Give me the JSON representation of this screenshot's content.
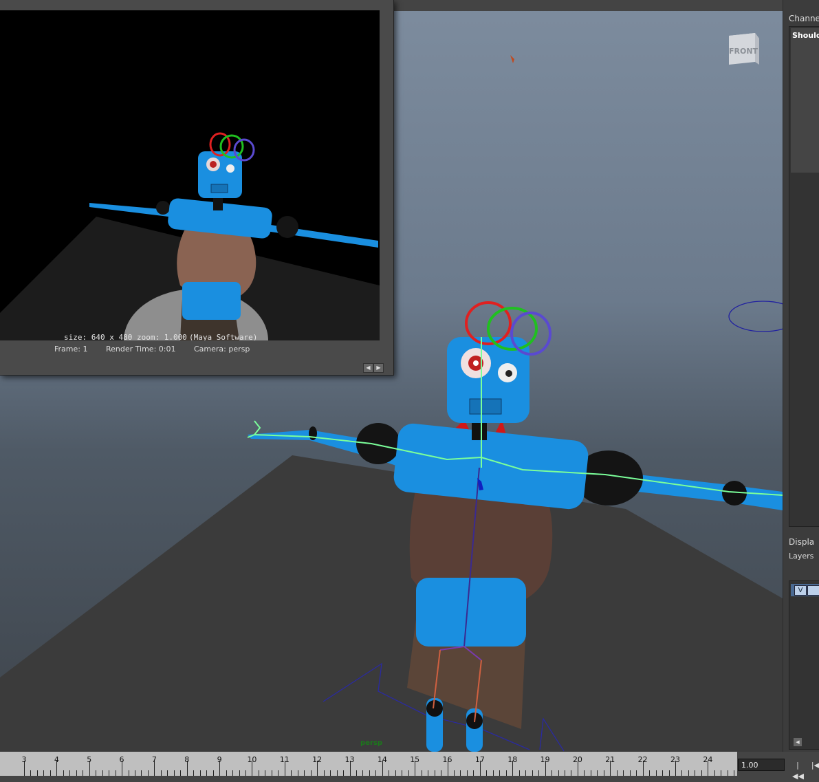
{
  "render_view": {
    "size_label": "size: 640 x 480 zoom: 1.000",
    "renderer_label": "(Maya Software)",
    "frame_label": "Frame: 1",
    "render_time_label": "Render Time: 0:01",
    "camera_label": "Camera: persp"
  },
  "viewport": {
    "camera_name": "persp",
    "viewcube_face": "FRONT"
  },
  "channel_box": {
    "tab_label": "Channe",
    "selected_object": "Shoulde"
  },
  "layer_editor": {
    "tab_label": "Displa",
    "menu_label": "Layers",
    "layer_visibility_label": "V"
  },
  "timeline": {
    "ticks": [
      "3",
      "4",
      "5",
      "6",
      "7",
      "8",
      "9",
      "10",
      "11",
      "12",
      "13",
      "14",
      "15",
      "16",
      "17",
      "18",
      "19",
      "20",
      "21",
      "22",
      "23",
      "24"
    ],
    "current_frame": "1.00"
  },
  "colors": {
    "robot_blue": "#1a8fe0",
    "joint_green": "#7bff9a",
    "control_red": "#e02020",
    "control_green": "#20c020",
    "control_blue": "#5a4ad0",
    "viewport_top": "#7d8c9e"
  },
  "icons": {
    "go_to_start": "skip-to-start-icon",
    "step_back": "step-back-icon",
    "render_prev": "arrow-left-icon",
    "render_next": "arrow-right-icon"
  }
}
